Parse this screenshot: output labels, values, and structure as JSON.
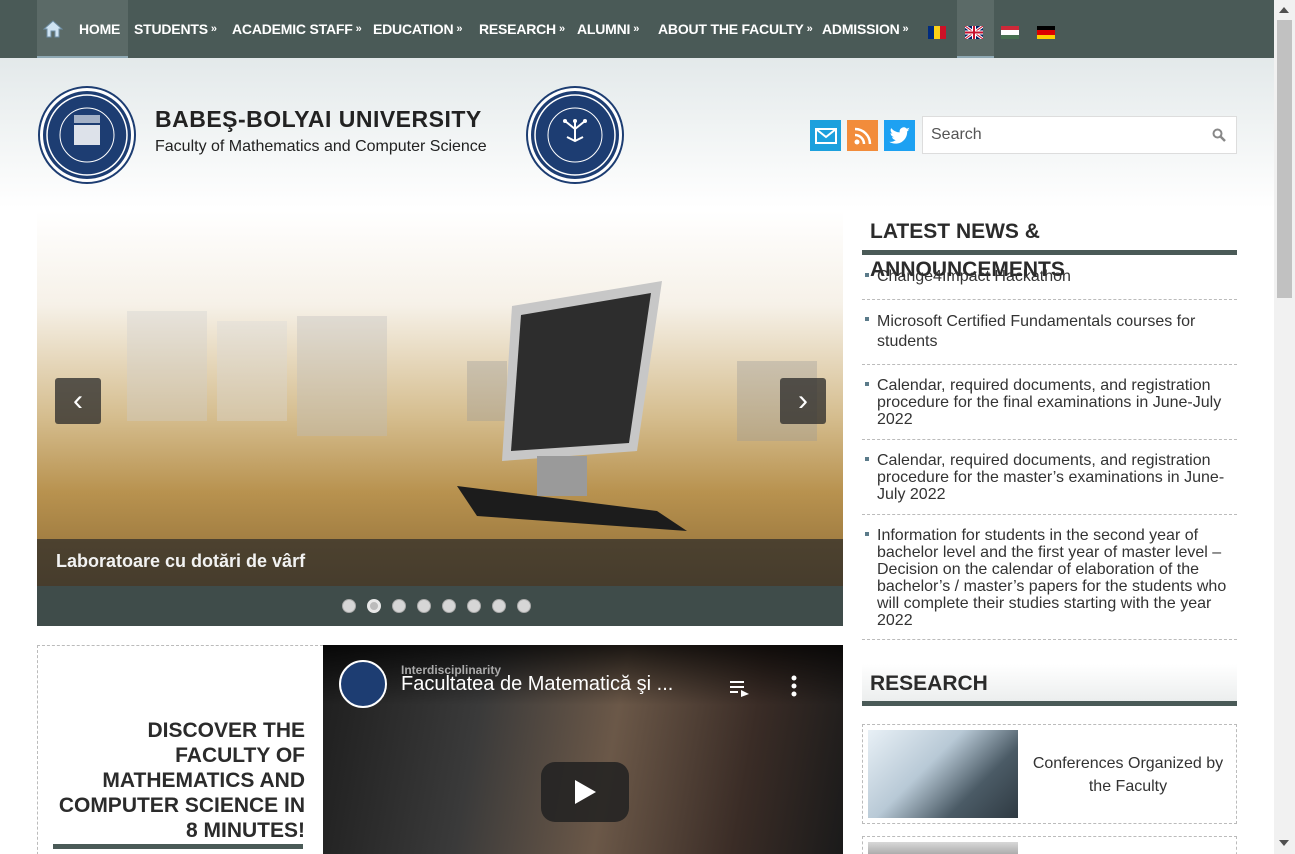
{
  "nav": {
    "items": [
      {
        "label": "HOME",
        "has_arrow": false
      },
      {
        "label": "STUDENTS",
        "has_arrow": true
      },
      {
        "label": "ACADEMIC STAFF",
        "has_arrow": true
      },
      {
        "label": "EDUCATION",
        "has_arrow": true
      },
      {
        "label": "RESEARCH",
        "has_arrow": true
      },
      {
        "label": "ALUMNI",
        "has_arrow": true
      },
      {
        "label": "ABOUT THE FACULTY",
        "has_arrow": true
      },
      {
        "label": "ADMISSION",
        "has_arrow": true
      }
    ],
    "arrow": "»",
    "languages": [
      "ro",
      "en",
      "hu",
      "de"
    ]
  },
  "header": {
    "university": "BABEŞ-BOLYAI UNIVERSITY",
    "faculty": "Faculty of Mathematics and Computer Science",
    "search_placeholder": "Search"
  },
  "slider": {
    "caption": "Laboratoare cu dotări de vârf",
    "prev": "‹",
    "next": "›",
    "dot_count": 8,
    "active_dot": 1
  },
  "news": {
    "title": "LATEST NEWS & ANNOUNCEMENTS",
    "items": [
      "Change4Impact Hackathon",
      "Microsoft Certified Fundamentals courses for students",
      "Calendar, required documents, and registration procedure for the final examinations in June-July 2022",
      "Calendar, required documents, and registration procedure for the master’s examinations in June-July 2022",
      "Information for students in the second year of bachelor level and the first year of master level – Decision on the calendar of elaboration of the bachelor’s / master’s papers for the students who will complete their studies starting with the year 2022"
    ]
  },
  "research": {
    "title": "RESEARCH",
    "card_text": "Conferences Organized by the Faculty"
  },
  "discover": {
    "text": "DISCOVER THE FACULTY OF MATHEMATICS AND COMPUTER SCIENCE IN 8 MINUTES!"
  },
  "video": {
    "channel": "Interdisciplinarity",
    "title": "Facultatea de Matematică şi ..."
  },
  "colors": {
    "nav_bg": "#4a5a57",
    "accent": "#4a5a57",
    "logo_blue": "#1d3d72"
  }
}
